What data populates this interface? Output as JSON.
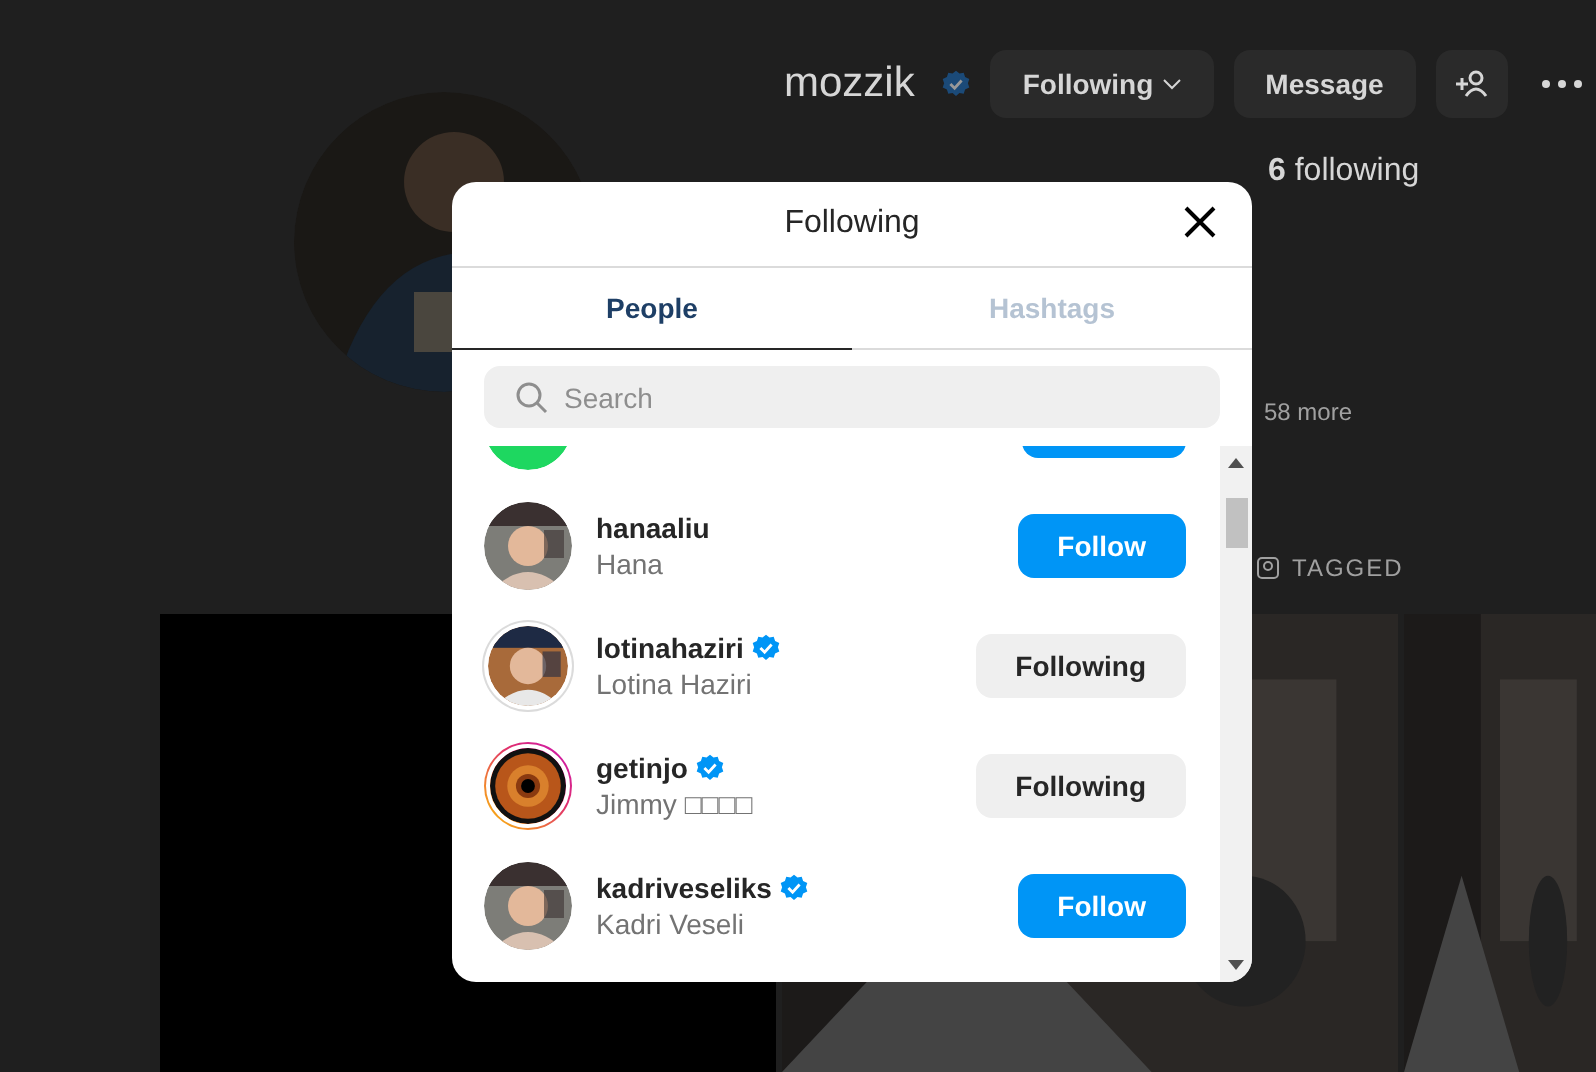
{
  "profile": {
    "username": "mozzik",
    "verified": true,
    "buttons": [
      {
        "label": "Following",
        "kind": "dropdown"
      },
      {
        "label": "Message",
        "kind": "plain"
      }
    ],
    "stats": [
      "**6** following"
    ],
    "mutual": "58 more",
    "tabs": [
      {
        "label": "TAGGED"
      }
    ],
    "posts": [
      {
        "kind": "blank"
      },
      {
        "kind": "picture"
      },
      {
        "kind": "picture"
      }
    ]
  },
  "dialog": {
    "title": "Following",
    "tabs": [
      {
        "label": "People",
        "selected": true
      },
      {
        "label": "Hashtags",
        "selected": false
      }
    ],
    "search": {
      "placeholder": "Search"
    },
    "accounts": [
      {
        "kind": "logo",
        "following": false
      },
      {
        "kind": "picture",
        "username": "hanaaliu",
        "verified": false,
        "name": "Hana",
        "story": false,
        "seen": false,
        "button": "Follow",
        "following": false
      },
      {
        "kind": "picture",
        "username": "lotinahaziri",
        "verified": true,
        "name": "Lotina Haziri",
        "story": false,
        "seen": true,
        "button": "Following",
        "following": true
      },
      {
        "kind": "eye",
        "username": "getinjo",
        "verified": true,
        "name": "Jimmy □□□□",
        "story": true,
        "seen": false,
        "button": "Following",
        "following": true
      },
      {
        "kind": "picture",
        "username": "kadriveseliks",
        "verified": true,
        "name": "Kadri Veseli",
        "story": false,
        "seen": false,
        "button": "Follow",
        "following": false
      }
    ]
  }
}
